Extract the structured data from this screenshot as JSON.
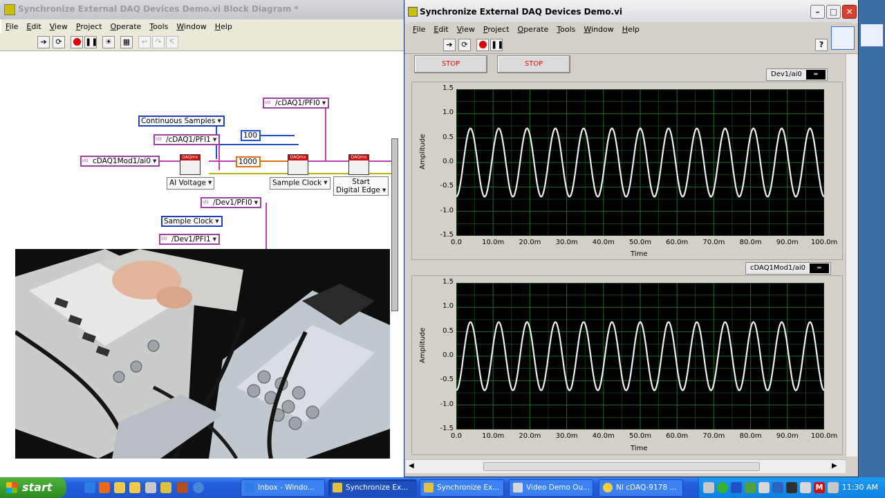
{
  "block_diagram": {
    "title": "Synchronize External DAQ Devices Demo.vi Block Diagram *",
    "menu": [
      "File",
      "Edit",
      "View",
      "Project",
      "Operate",
      "Tools",
      "Window",
      "Help"
    ],
    "constants": {
      "pfi_cdaq_top": "/cDAQ1/PFI0",
      "continuous_samples": "Continuous Samples",
      "pfi_cdaq_trig": "/cDAQ1/PFI1",
      "samples": "100",
      "rate": "1000",
      "channel": "cDAQ1Mod1/ai0",
      "ai_voltage": "AI Voltage",
      "sample_clock": "Sample Clock",
      "start_digital_edge_1": "Start",
      "start_digital_edge_2": "Digital Edge",
      "pfi_dev1_top": "/Dev1/PFI0",
      "sample_clock_2": "Sample Clock",
      "pfi_dev1_trig": "/Dev1/PFI1"
    },
    "vi_header": "DAQmx"
  },
  "front_panel": {
    "title": "Synchronize External DAQ Devices Demo.vi",
    "menu": [
      "File",
      "Edit",
      "View",
      "Project",
      "Operate",
      "Tools",
      "Window",
      "Help"
    ],
    "stop_labels": [
      "STOP",
      "STOP"
    ],
    "graphs": [
      {
        "legend": "Dev1/ai0",
        "ylabel": "Amplitude",
        "xlabel": "Time"
      },
      {
        "legend": "cDAQ1Mod1/ai0",
        "ylabel": "Amplitude",
        "xlabel": "Time"
      }
    ],
    "help_glyph": "?"
  },
  "chart_data": [
    {
      "type": "line",
      "title": "",
      "legend": "Dev1/ai0",
      "xlabel": "Time",
      "ylabel": "Amplitude",
      "xlim": [
        0,
        100
      ],
      "ylim": [
        -1.5,
        1.5
      ],
      "x_ticks": [
        "0.0",
        "10.0m",
        "20.0m",
        "30.0m",
        "40.0m",
        "50.0m",
        "60.0m",
        "70.0m",
        "80.0m",
        "90.0m",
        "100.0m"
      ],
      "y_ticks": [
        "1.5",
        "1.0",
        "0.5",
        "0.0",
        "-0.5",
        "-1.0",
        "-1.5"
      ],
      "grid": true,
      "series": [
        {
          "name": "Dev1/ai0",
          "frequency_cycles": 13,
          "amplitude": 0.7,
          "phase_start": -0.6,
          "color": "#f0f0f0"
        }
      ]
    },
    {
      "type": "line",
      "title": "",
      "legend": "cDAQ1Mod1/ai0",
      "xlabel": "Time",
      "ylabel": "Amplitude",
      "xlim": [
        0,
        100
      ],
      "ylim": [
        -1.5,
        1.5
      ],
      "x_ticks": [
        "0.0",
        "10.0m",
        "20.0m",
        "30.0m",
        "40.0m",
        "50.0m",
        "60.0m",
        "70.0m",
        "80.0m",
        "90.0m",
        "100.0m"
      ],
      "y_ticks": [
        "1.5",
        "1.0",
        "0.5",
        "0.0",
        "-0.5",
        "-1.0",
        "-1.5"
      ],
      "grid": true,
      "series": [
        {
          "name": "cDAQ1Mod1/ai0",
          "frequency_cycles": 13,
          "amplitude": 0.7,
          "phase_start": -0.6,
          "color": "#f0f0f0"
        }
      ]
    }
  ],
  "taskbar": {
    "start_label": "start",
    "tasks": [
      "Inbox - Windo...",
      "Synchronize Ex...",
      "Synchronize Ex...",
      "Video Demo Ou...",
      "NI cDAQ-9178 ..."
    ],
    "clock": "11:30 AM"
  },
  "colors": {
    "plot_bg": "#000000",
    "grid": "#1f6b2e",
    "trace": "#f0f0f0",
    "stop_text": "#e01010"
  }
}
